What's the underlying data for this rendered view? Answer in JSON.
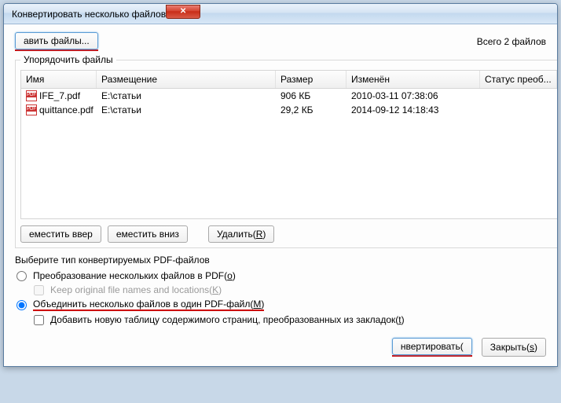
{
  "window": {
    "title": "Конвертировать несколько файлов"
  },
  "top": {
    "add_files_label": "авить файлы...",
    "total_files": "Всего 2 файлов"
  },
  "group": {
    "organize_label": "Упорядочить файлы"
  },
  "table": {
    "headers": {
      "name": "Имя",
      "location": "Размещение",
      "size": "Размер",
      "modified": "Изменён",
      "status": "Статус преоб..."
    },
    "rows": [
      {
        "name": "IFE_7.pdf",
        "location": "E:\\статьи",
        "size": "906 КБ",
        "modified": "2010-03-11 07:38:06",
        "status": ""
      },
      {
        "name": "quittance.pdf",
        "location": "E:\\статьи",
        "size": "29,2 КБ",
        "modified": "2014-09-12 14:18:43",
        "status": ""
      }
    ]
  },
  "buttons": {
    "move_up": "еместить ввер",
    "move_down": "еместить вниз",
    "delete_pre": "Удалить(",
    "delete_mn": "R",
    "delete_post": ")"
  },
  "options": {
    "title": "Выберите тип конвертируемых PDF-файлов",
    "radio_multi_pre": "Преобразование нескольких файлов в PDF(",
    "radio_multi_mn": "o",
    "radio_multi_post": ")",
    "keep_pre": "Keep original file names and locations(",
    "keep_mn": "K",
    "keep_post": ")",
    "radio_merge_pre": "Объединить несколько файлов в один PDF-файл(",
    "radio_merge_mn": "M",
    "radio_merge_post": ")",
    "add_toc_pre": "Добавить новую таблицу содержимого страниц, преобразованных из закладок(",
    "add_toc_mn": "t",
    "add_toc_post": ")"
  },
  "footer": {
    "convert_label": "нвертировать(",
    "close_pre": "Закрыть(",
    "close_mn": "s",
    "close_post": ")"
  }
}
